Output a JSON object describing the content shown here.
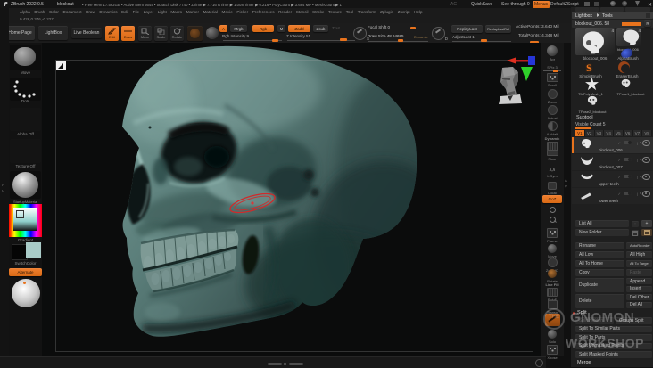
{
  "accent": "#e8731d",
  "titlebar": {
    "app": "ZBrush 2022.0.5",
    "doc": "blockout",
    "stats": "• Free Mem 17.562GB • Active Mem 6644 • Scratch Disk 7740 • ZTime ▶ 7.716 RTime ▶ 1.008 Timer ▶ 0.216 • PolyCount ▶ 3.684 MP • MeshCount ▶ 1",
    "ac": "AC",
    "quicksave": "QuickSave",
    "seethrough": "See-through 0",
    "menus": "Menus",
    "zscript": "DefaultZScript",
    "close": "✕"
  },
  "menubar": {
    "items": [
      "Alpha",
      "Brush",
      "Color",
      "Document",
      "Draw",
      "Dynamics",
      "Edit",
      "File",
      "Layer",
      "Light",
      "Macro",
      "Marker",
      "Material",
      "Movie",
      "Picker",
      "Preferences",
      "Render",
      "Stencil",
      "Stroke",
      "Texture",
      "Tool",
      "Transform",
      "Zplugin",
      "Zscript",
      "Help"
    ],
    "coords": "0.426,0.376,-0.227"
  },
  "toolbar": {
    "home": "Home Page",
    "lightbox": "LightBox",
    "liveboolean": "Live Boolean",
    "edit": "Edit",
    "draw": "Draw",
    "move": "Move",
    "scale": "Scale",
    "rotate": "Rotate",
    "a": "A",
    "mrgb": "Mrgb",
    "rgb": "Rgb",
    "m": "M",
    "zadd": "Zadd",
    "zsub": "Zsub",
    "zcut": "Zcut",
    "rgb_intensity": "Rgb Intensity 9",
    "z_intensity": "Z Intensity 51",
    "s": "S",
    "d": "D",
    "focal_shift": "Focal Shift 0",
    "draw_size": "Draw Size 48.64685",
    "dynamic": "Dynamic",
    "replay_last": "ReplayLast",
    "replay_last_rel": "ReplayLastRel",
    "adjust_last": "AdjustLast 1",
    "active_points": "ActivePoints: 3.640 Mil",
    "total_points": "TotalPoints: 4.348 Mil"
  },
  "left_shelf": {
    "move": "Move",
    "dots": "Dots",
    "alpha": "Alpha Off",
    "texture": "Texture Off",
    "material": "StartupMaterial",
    "gradient": "Gradient",
    "switchcolor": "SwitchColor",
    "alternate": "Alternate"
  },
  "right_shelf": {
    "bpr": "Bpr",
    "spix": "SPix 3",
    "scroll": "Scroll",
    "zoom": "Zoom",
    "actual": "Actual",
    "aahalf": "AAHalf",
    "dynamic": "Dynamic",
    "persp": "Persp",
    "floor": "Floor",
    "lsym": "L.Sym",
    "local": "Local",
    "goz": "GoZ",
    "frame": "Frame",
    "move": "Move",
    "zoomid": "ZoomID",
    "rotate": "Rotate",
    "linefill": "Line Fill",
    "polyf": "PolyF",
    "transp": "Transp",
    "solo": "Solo",
    "xpose": "Xpose"
  },
  "tool_panel": {
    "header1": "Lightbox",
    "header2": "Tools",
    "tool_slider": "blockout_006. 58",
    "r": "R",
    "tools": [
      {
        "name": "blockout_006",
        "badge": "4"
      },
      {
        "name": "blockout_006",
        "badge": "4"
      },
      {
        "name": "AlphaBrush"
      },
      {
        "name": "SimpleBrush"
      },
      {
        "name": "EraserBrush"
      },
      {
        "name": "TMPolyMesh_1"
      },
      {
        "name": "TPose1_blockout"
      },
      {
        "name": "TPose2_blockout"
      }
    ],
    "subtool": {
      "title": "Subtool",
      "visible_count": "Visible Count 5",
      "tabs": [
        "V1",
        "V2",
        "V3",
        "V4",
        "V5",
        "V6",
        "V7",
        "V8"
      ],
      "items": [
        {
          "name": "blockout_006"
        },
        {
          "name": "blockout_007"
        },
        {
          "name": "upper teeth"
        },
        {
          "name": "lower teeth"
        }
      ],
      "list_all": "List All",
      "plus": "+",
      "new_folder": "New Folder",
      "buttons": {
        "rename": "Rename",
        "autoreorder": "AutoReorder",
        "all_low": "All Low",
        "all_high": "All High",
        "all_to_home": "All To Home",
        "all_to_target": "All To Target",
        "copy": "Copy",
        "paste": "Paste",
        "duplicate": "Duplicate",
        "append": "Append",
        "insert": "Insert",
        "del": "Delete",
        "del_other": "Del Other",
        "del_all": "Del All",
        "split": "Split",
        "split_hidden": "Split Hidden",
        "groups_split": "Groups Split",
        "split_similar": "Split To Similar Parts",
        "split_parts": "Split To Parts",
        "split_unmasked": "Split Unmasked Points",
        "split_masked": "Split Masked Points",
        "merge": "Merge"
      }
    }
  },
  "watermark": {
    "the": "THE",
    "l1": "GNOMON",
    "l2": "WORKSHOP"
  }
}
